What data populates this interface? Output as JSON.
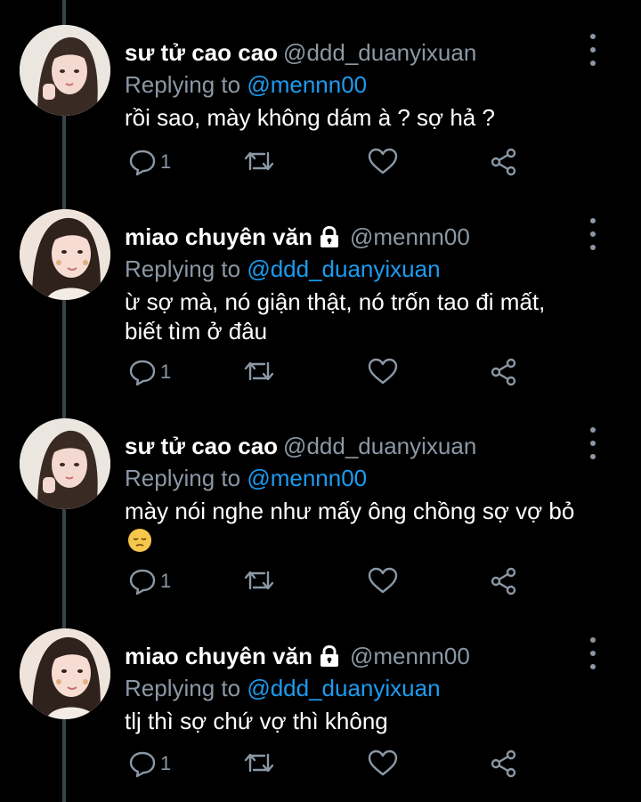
{
  "tweets": [
    {
      "name": "sư tử cao cao",
      "handle": "@ddd_duanyixuan",
      "replying_prefix": "Replying to",
      "replying_to": "@mennn00",
      "text": "rồi sao, mày không dám à ? sợ hả ?",
      "reply_count": "1",
      "locked": false,
      "avatar": "avatar-girl-1"
    },
    {
      "name": "miao chuyên văn",
      "handle": "@mennn00",
      "replying_prefix": "Replying to",
      "replying_to": "@ddd_duanyixuan",
      "text": "ừ sợ mà, nó giận thật, nó trốn tao đi mất, biết tìm ở đâu",
      "reply_count": "1",
      "locked": true,
      "avatar": "avatar-girl-2"
    },
    {
      "name": "sư tử cao cao",
      "handle": "@ddd_duanyixuan",
      "replying_prefix": "Replying to",
      "replying_to": "@mennn00",
      "text": "mày nói nghe như mấy ông chồng sợ vợ bỏ",
      "reply_count": "1",
      "locked": false,
      "avatar": "avatar-girl-1",
      "emoji": "pensive-face"
    },
    {
      "name": "miao chuyên văn",
      "handle": "@mennn00",
      "replying_prefix": "Replying to",
      "replying_to": "@ddd_duanyixuan",
      "text": "tlj thì sợ chứ vợ thì không",
      "reply_count": "1",
      "locked": true,
      "avatar": "avatar-girl-2"
    }
  ],
  "icons": [
    "reply-icon",
    "retweet-icon",
    "like-icon",
    "share-icon",
    "more-icon",
    "lock-icon"
  ],
  "colors": {
    "background": "#000000",
    "text": "#ffffff",
    "muted": "#8b98a5",
    "link": "#1d9bf0",
    "thread_line": "#38444d"
  }
}
